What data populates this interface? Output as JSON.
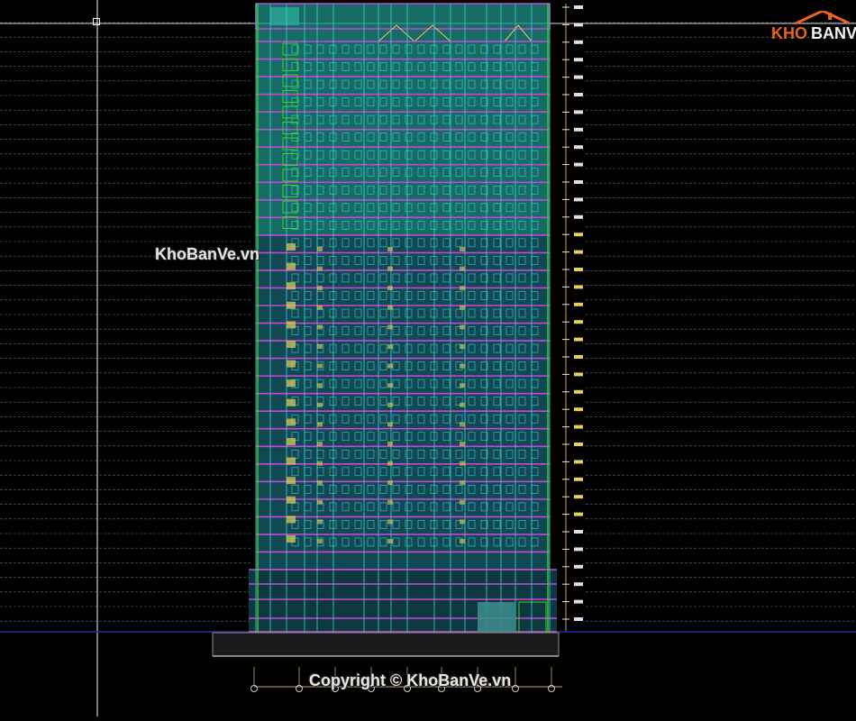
{
  "watermark": {
    "middle": "KhoBanVe.vn",
    "bottom": "Copyright © KhoBanVe.vn"
  },
  "logo": {
    "part1": "KHO",
    "part2": "BANVE",
    "brand_color": "#e8651d"
  },
  "drawing": {
    "background": "#000000",
    "floors_upper": 8,
    "floors_middle": 19,
    "colors": {
      "frame": "#c845d8",
      "facade_upper": "#1e8f86",
      "facade_lower": "#1a6f7c",
      "window": "#3ed0d8",
      "green": "#39d12a",
      "yellow": "#e5d15a",
      "dim_line": "#c9a56a",
      "grid_line": "#9a9a9a",
      "ground": "#2a2aa0"
    },
    "icons": [
      "crosshair-icon",
      "logo-house-icon"
    ]
  }
}
